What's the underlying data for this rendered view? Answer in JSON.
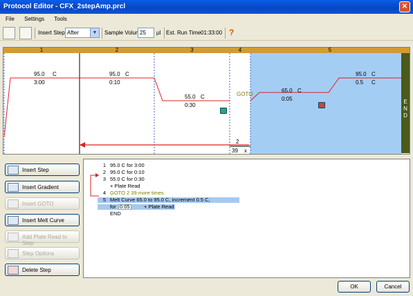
{
  "window": {
    "title": "Protocol Editor - CFX_2stepAmp.prcl",
    "close": "✕"
  },
  "menu": [
    "File",
    "Settings",
    "Tools"
  ],
  "toolbar": {
    "insert_step_label": "Insert Step",
    "insert_step_value": "After",
    "sample_volume_label": "Sample Volume",
    "sample_volume_value": "25",
    "sample_volume_unit": "µl",
    "run_time_label": "Est. Run Time",
    "run_time_value": "01:33:00",
    "help": "?"
  },
  "graph": {
    "steps": [
      "1",
      "2",
      "3",
      "4",
      "5"
    ],
    "step1": {
      "temp": "95.0",
      "unit": "C",
      "time": "3:00"
    },
    "step2": {
      "temp": "95.0",
      "unit": "C",
      "time": "0:10"
    },
    "step3": {
      "temp": "55.0",
      "unit": "C",
      "time": "0:30"
    },
    "goto": {
      "label": "GOTO",
      "target": "2",
      "times": "39",
      "x": "x"
    },
    "step5": {
      "start_temp": "65.0",
      "start_unit": "C",
      "increment_time": "0:05",
      "end_temp": "95.0",
      "end_unit": "C",
      "increment": "0.5"
    },
    "end": "END"
  },
  "buttons": {
    "insert_step": "Insert Step",
    "insert_gradient": "Insert Gradient",
    "insert_goto": "Insert GOTO",
    "insert_melt": "Insert Melt Curve",
    "add_plate_read": "Add Plate Read to Step",
    "step_options": "Step Options",
    "delete_step": "Delete Step"
  },
  "list": {
    "r1": {
      "num": "1",
      "text": "95.0     C   for 3:00"
    },
    "r2": {
      "num": "2",
      "text": "95.0     C   for 0:10"
    },
    "r3": {
      "num": "3",
      "text": "55.0     C   for 0:30"
    },
    "r3b": {
      "text": "+ Plate Read"
    },
    "r4": {
      "num": "4",
      "text": "GOTO  2        39        more times"
    },
    "r5": {
      "num": "5",
      "text": "Melt Curve   65.0       to 95.0       C, increment     0.5        C,"
    },
    "r5b": {
      "for": "for",
      "time": "0:05",
      "plate": "+ Plate Read"
    },
    "end": {
      "text": "END"
    }
  },
  "dialog": {
    "ok": "OK",
    "cancel": "Cancel"
  }
}
